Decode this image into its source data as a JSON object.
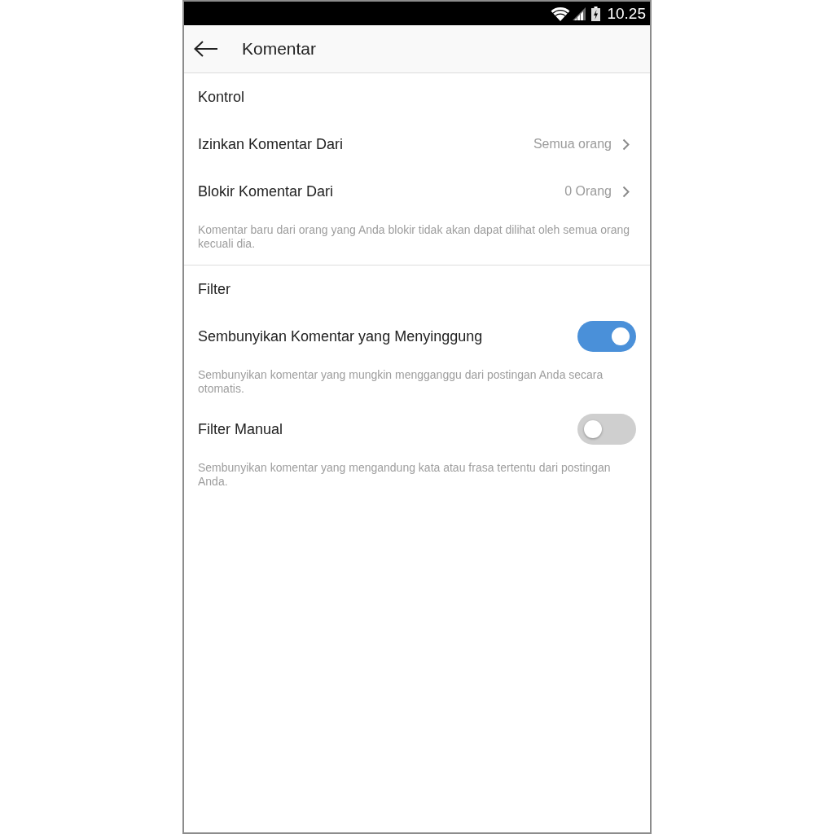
{
  "status_bar": {
    "time": "10.25"
  },
  "app_bar": {
    "title": "Komentar"
  },
  "sections": [
    {
      "header": "Kontrol",
      "items": [
        {
          "kind": "link",
          "label": "Izinkan Komentar Dari",
          "value": "Semua orang"
        },
        {
          "kind": "link",
          "label": "Blokir Komentar Dari",
          "value": "0 Orang"
        },
        {
          "kind": "note",
          "text": "Komentar baru dari orang yang Anda blokir tidak akan dapat dilihat oleh semua orang kecuali dia."
        }
      ]
    },
    {
      "header": "Filter",
      "items": [
        {
          "kind": "toggle",
          "label": "Sembunyikan Komentar yang Menyinggung",
          "on": true
        },
        {
          "kind": "note",
          "text": "Sembunyikan komentar yang mungkin mengganggu dari postingan Anda secara otomatis."
        },
        {
          "kind": "toggle",
          "label": "Filter Manual",
          "on": false
        },
        {
          "kind": "note",
          "text": "Sembunyikan komentar yang mengandung kata atau frasa tertentu dari postingan Anda."
        }
      ]
    }
  ]
}
